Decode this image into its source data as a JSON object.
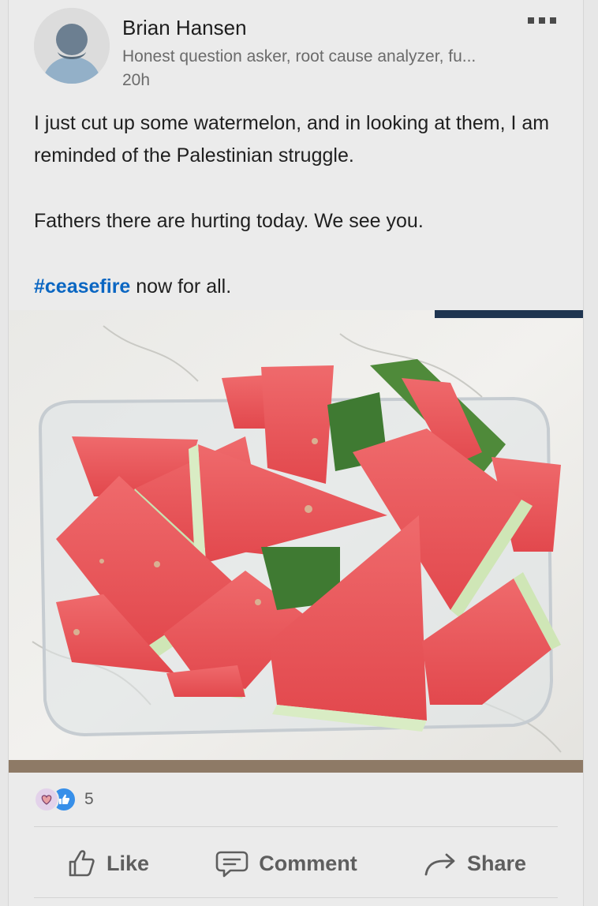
{
  "post": {
    "author": {
      "name": "Brian Hansen",
      "headline": "Honest question asker, root cause analyzer, fu...",
      "time": "20h"
    },
    "text": {
      "line1": "I just cut up some watermelon, and in looking at them, I am reminded of the Palestinian struggle.",
      "line2": "Fathers there are hurting today. We see you.",
      "hashtag": "#ceasefire",
      "line3_rest": " now for all."
    },
    "image": {
      "subject": "watermelon-slices-in-plastic-container"
    }
  },
  "reactions": {
    "icons": [
      "love-reaction-icon",
      "like-reaction-icon"
    ],
    "count": "5"
  },
  "actions": {
    "like": "Like",
    "comment": "Comment",
    "share": "Share"
  },
  "colors": {
    "hashtag": "#0a66c2",
    "like_reaction": "#378fe9",
    "action_text": "#5e5e5e"
  }
}
